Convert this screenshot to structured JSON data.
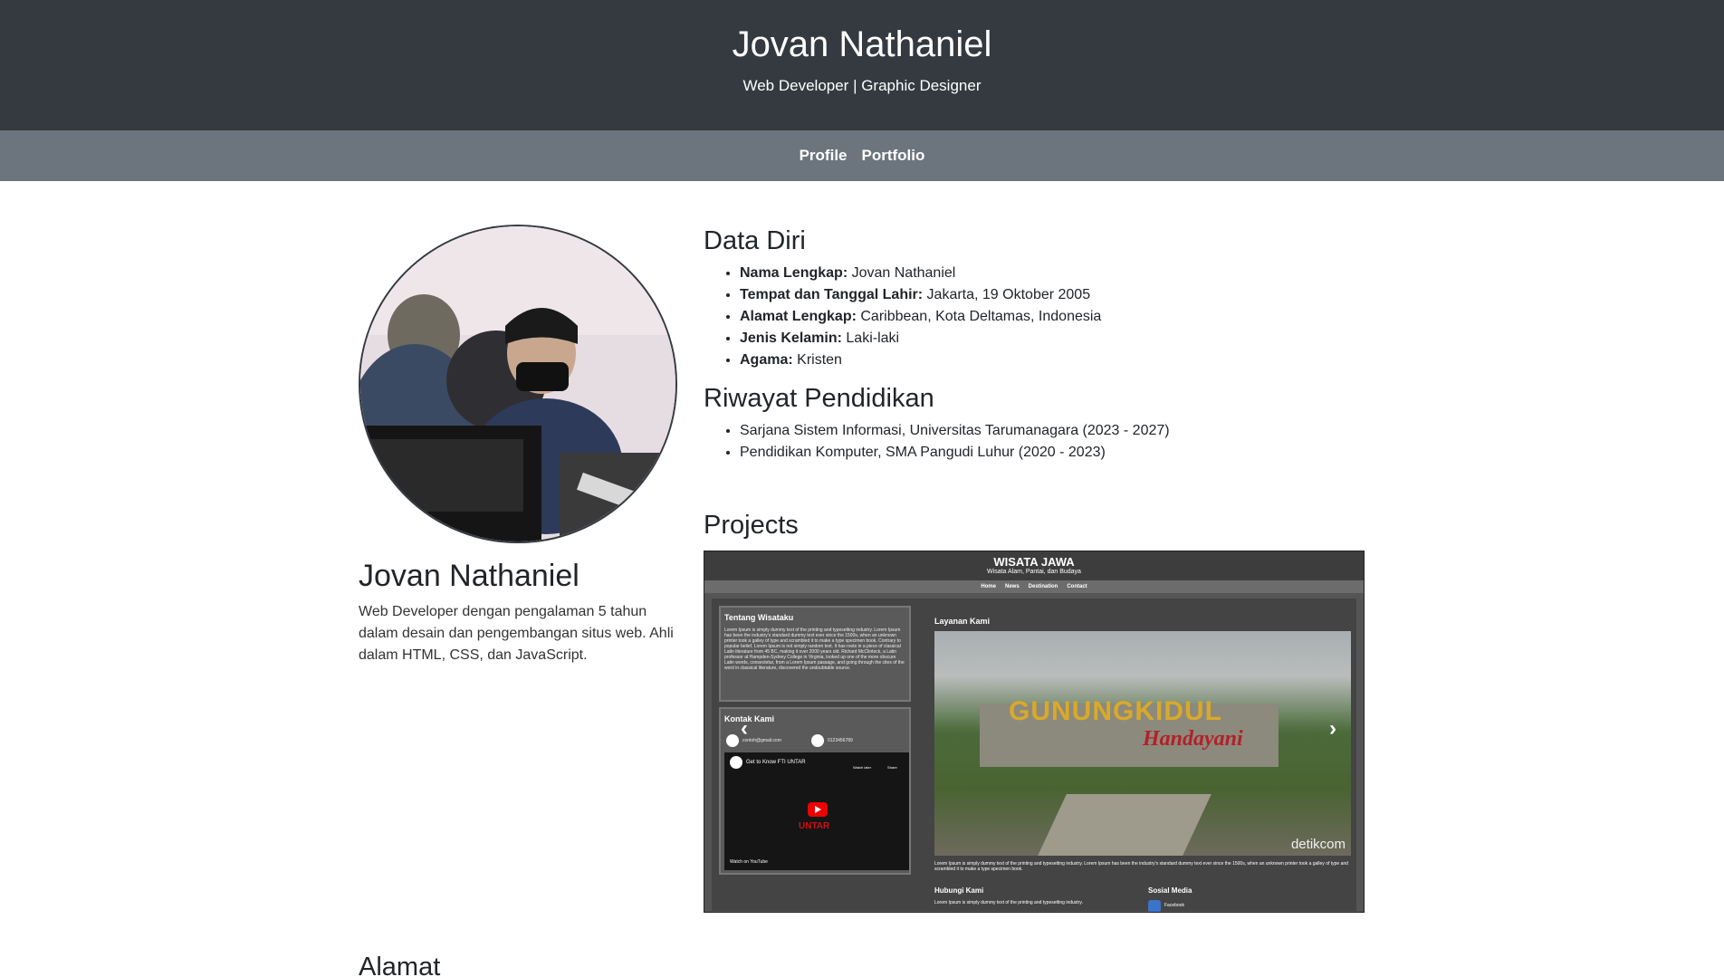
{
  "header": {
    "title": "Jovan Nathaniel",
    "subtitle": "Web Developer | Graphic Designer"
  },
  "nav": {
    "items": [
      {
        "label": "Profile"
      },
      {
        "label": "Portfolio"
      }
    ]
  },
  "profile": {
    "name": "Jovan Nathaniel",
    "bio": "Web Developer dengan pengalaman 5 tahun dalam desain dan pengembangan situs web. Ahli dalam HTML, CSS, dan JavaScript."
  },
  "data_diri": {
    "heading": "Data Diri",
    "items": [
      {
        "label": "Nama Lengkap:",
        "value": "Jovan Nathaniel"
      },
      {
        "label": "Tempat dan Tanggal Lahir:",
        "value": "Jakarta, 19 Oktober 2005"
      },
      {
        "label": "Alamat Lengkap:",
        "value": "Caribbean, Kota Deltamas, Indonesia"
      },
      {
        "label": "Jenis Kelamin:",
        "value": "Laki-laki"
      },
      {
        "label": "Agama:",
        "value": "Kristen"
      }
    ]
  },
  "pendidikan": {
    "heading": "Riwayat Pendidikan",
    "items": [
      "Sarjana Sistem Informasi, Universitas Tarumanagara (2023 - 2027)",
      "Pendidikan Komputer, SMA Pangudi Luhur (2020 - 2023)"
    ]
  },
  "projects": {
    "heading": "Projects",
    "screenshot": {
      "site_title": "WISATA JAWA",
      "site_subtitle": "Wisata Alam, Pantai, dan Budaya",
      "nav": [
        "Home",
        "News",
        "Destination",
        "Contact"
      ],
      "card1_title": "Tentang Wisataku",
      "card1_text": "Lorem Ipsum is simply dummy text of the printing and typesetting industry. Lorem Ipsum has been the industry's standard dummy text ever since the 1500s, when an unknown printer took a galley of type and scrambled it to make a type specimen book. Contrary to popular belief, Lorem Ipsum is not simply random text. It has roots in a piece of classical Latin literature from 45 BC, making it over 2000 years old. Richard McClintock, a Latin professor at Hampden-Sydney College in Virginia, looked up one of the more obscure Latin words, consectetur, from a Lorem Ipsum passage, and going through the cites of the word in classical literature, discovered the undoubtable source.",
      "card2_title": "Kontak Kami",
      "email": "contoh@gmail.com",
      "phone": "0123456789",
      "video_title": "Get to Know FTI UNTAR",
      "video_watch_later": "Watch later",
      "video_share": "Share",
      "video_brand": "UNTAR",
      "video_footer": "Watch on YouTube",
      "services_title": "Layanan Kami",
      "sign_text": "GUNUNGKIDUL",
      "sign_sub": "Handayani",
      "watermark": "detikcom",
      "caption": "Lorem Ipsum is simply dummy text of the printing and typesetting industry. Lorem Ipsum has been the industry's standard dummy text ever since the 1500s, when an unknown printer took a galley of type and scrambled it to make a type specimen book.",
      "hubungi_title": "Hubungi Kami",
      "hubungi_text": "Lorem Ipsum is simply dummy text of the printing and typesetting industry.",
      "sosial_title": "Sosial Media",
      "sosial_item": "Facebook"
    }
  },
  "alamat": {
    "heading": "Alamat"
  }
}
